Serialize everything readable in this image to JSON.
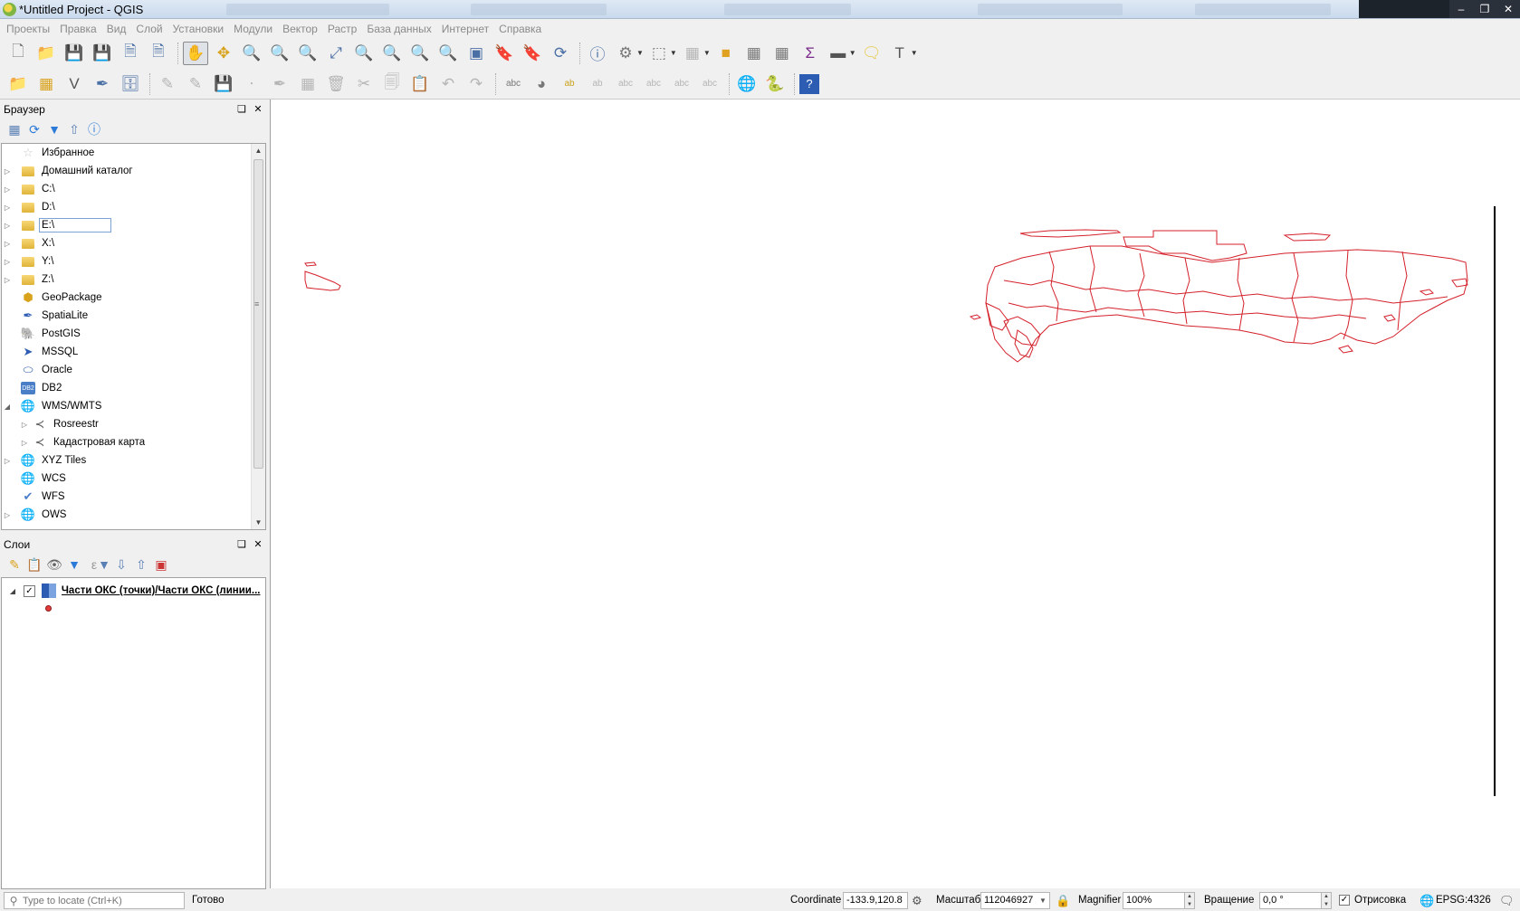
{
  "window": {
    "title": "*Untitled Project - QGIS"
  },
  "menu": [
    "Проекты",
    "Правка",
    "Вид",
    "Слой",
    "Установки",
    "Модули",
    "Вектор",
    "Растр",
    "База данных",
    "Интернет",
    "Справка"
  ],
  "browser_panel": {
    "title": "Браузер",
    "items": [
      {
        "label": "Избранное",
        "icon": "star-icon",
        "expandable": false
      },
      {
        "label": "Домашний каталог",
        "icon": "folder-icon",
        "expandable": true
      },
      {
        "label": "C:\\",
        "icon": "folder-icon",
        "expandable": true
      },
      {
        "label": "D:\\",
        "icon": "folder-icon",
        "expandable": true
      },
      {
        "label": "E:\\",
        "icon": "folder-icon",
        "expandable": true,
        "selected": true
      },
      {
        "label": "X:\\",
        "icon": "folder-icon",
        "expandable": true
      },
      {
        "label": "Y:\\",
        "icon": "folder-icon",
        "expandable": true
      },
      {
        "label": "Z:\\",
        "icon": "folder-icon",
        "expandable": true
      },
      {
        "label": "GeoPackage",
        "icon": "geopackage-icon",
        "expandable": false
      },
      {
        "label": "SpatiaLite",
        "icon": "spatialite-icon",
        "expandable": false
      },
      {
        "label": "PostGIS",
        "icon": "postgis-icon",
        "expandable": false
      },
      {
        "label": "MSSQL",
        "icon": "mssql-icon",
        "expandable": false
      },
      {
        "label": "Oracle",
        "icon": "oracle-icon",
        "expandable": false
      },
      {
        "label": "DB2",
        "icon": "db2-icon",
        "expandable": false
      },
      {
        "label": "WMS/WMTS",
        "icon": "globe-icon",
        "expandable": true,
        "expanded": true
      },
      {
        "label": "Rosreestr",
        "icon": "wms-connection-icon",
        "expandable": true,
        "child": true
      },
      {
        "label": "Кадастровая карта",
        "icon": "wms-connection-icon",
        "expandable": true,
        "child": true
      },
      {
        "label": "XYZ Tiles",
        "icon": "globe-icon",
        "expandable": true
      },
      {
        "label": "WCS",
        "icon": "globe-icon",
        "expandable": false
      },
      {
        "label": "WFS",
        "icon": "wfs-icon",
        "expandable": false
      },
      {
        "label": "OWS",
        "icon": "globe-icon",
        "expandable": true
      }
    ]
  },
  "layers_panel": {
    "title": "Слои",
    "layer": {
      "name": "Части ОКС (точки)/Части ОКС (линии...",
      "checked": true,
      "point_color": "#e43b3b"
    }
  },
  "map": {
    "feature_color": "#d4202a"
  },
  "statusbar": {
    "locator_placeholder": "Type to locate (Ctrl+K)",
    "status": "Готово",
    "coordinate_label": "Coordinate",
    "coordinate": "-133.9,120.8",
    "scale_label": "Масштаб",
    "scale": "112046927",
    "magnifier_label": "Magnifier",
    "magnifier": "100%",
    "rotation_label": "Вращение",
    "rotation": "0,0 °",
    "render_label": "Отрисовка",
    "render_checked": true,
    "crs": "EPSG:4326"
  }
}
